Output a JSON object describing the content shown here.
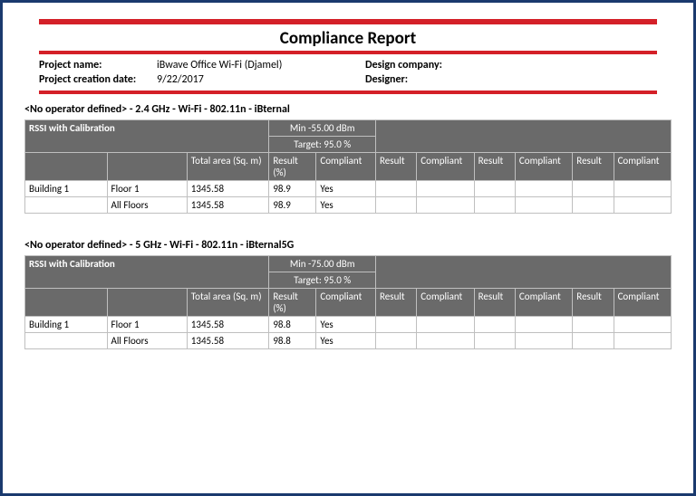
{
  "title": "Compliance Report",
  "meta": {
    "project_name_label": "Project name:",
    "project_name": "iBwave Office Wi-Fi (Djamel)",
    "creation_date_label": "Project creation date:",
    "creation_date": "9/22/2017",
    "design_company_label": "Design company:",
    "design_company": "",
    "designer_label": "Designer:",
    "designer": ""
  },
  "sections": [
    {
      "heading": "<No operator defined> - 2.4 GHz - Wi-Fi - 802.11n - iBternal",
      "metric_label": "RSSI with Calibration",
      "min_label": "Min -55.00 dBm",
      "target_label": "Target: 95.0 %",
      "area_header": "Total area (Sq. m)",
      "result_header": "Result (%)",
      "compliant_header": "Compliant",
      "extra_headers": [
        "Result",
        "Compliant",
        "Result",
        "Compliant",
        "Result",
        "Compliant"
      ],
      "rows": [
        {
          "building": "Building 1",
          "floor": "Floor 1",
          "area": "1345.58",
          "result": "98.9",
          "compliant": "Yes"
        },
        {
          "building": "",
          "floor": "All Floors",
          "area": "1345.58",
          "result": "98.9",
          "compliant": "Yes"
        }
      ]
    },
    {
      "heading": "<No operator defined> - 5 GHz - Wi-Fi - 802.11n - iBternal5G",
      "metric_label": "RSSI with Calibration",
      "min_label": "Min -75.00 dBm",
      "target_label": "Target: 95.0 %",
      "area_header": "Total area (Sq. m)",
      "result_header": "Result (%)",
      "compliant_header": "Compliant",
      "extra_headers": [
        "Result",
        "Compliant",
        "Result",
        "Compliant",
        "Result",
        "Compliant"
      ],
      "rows": [
        {
          "building": "Building 1",
          "floor": "Floor 1",
          "area": "1345.58",
          "result": "98.8",
          "compliant": "Yes"
        },
        {
          "building": "",
          "floor": "All Floors",
          "area": "1345.58",
          "result": "98.8",
          "compliant": "Yes"
        }
      ]
    }
  ]
}
